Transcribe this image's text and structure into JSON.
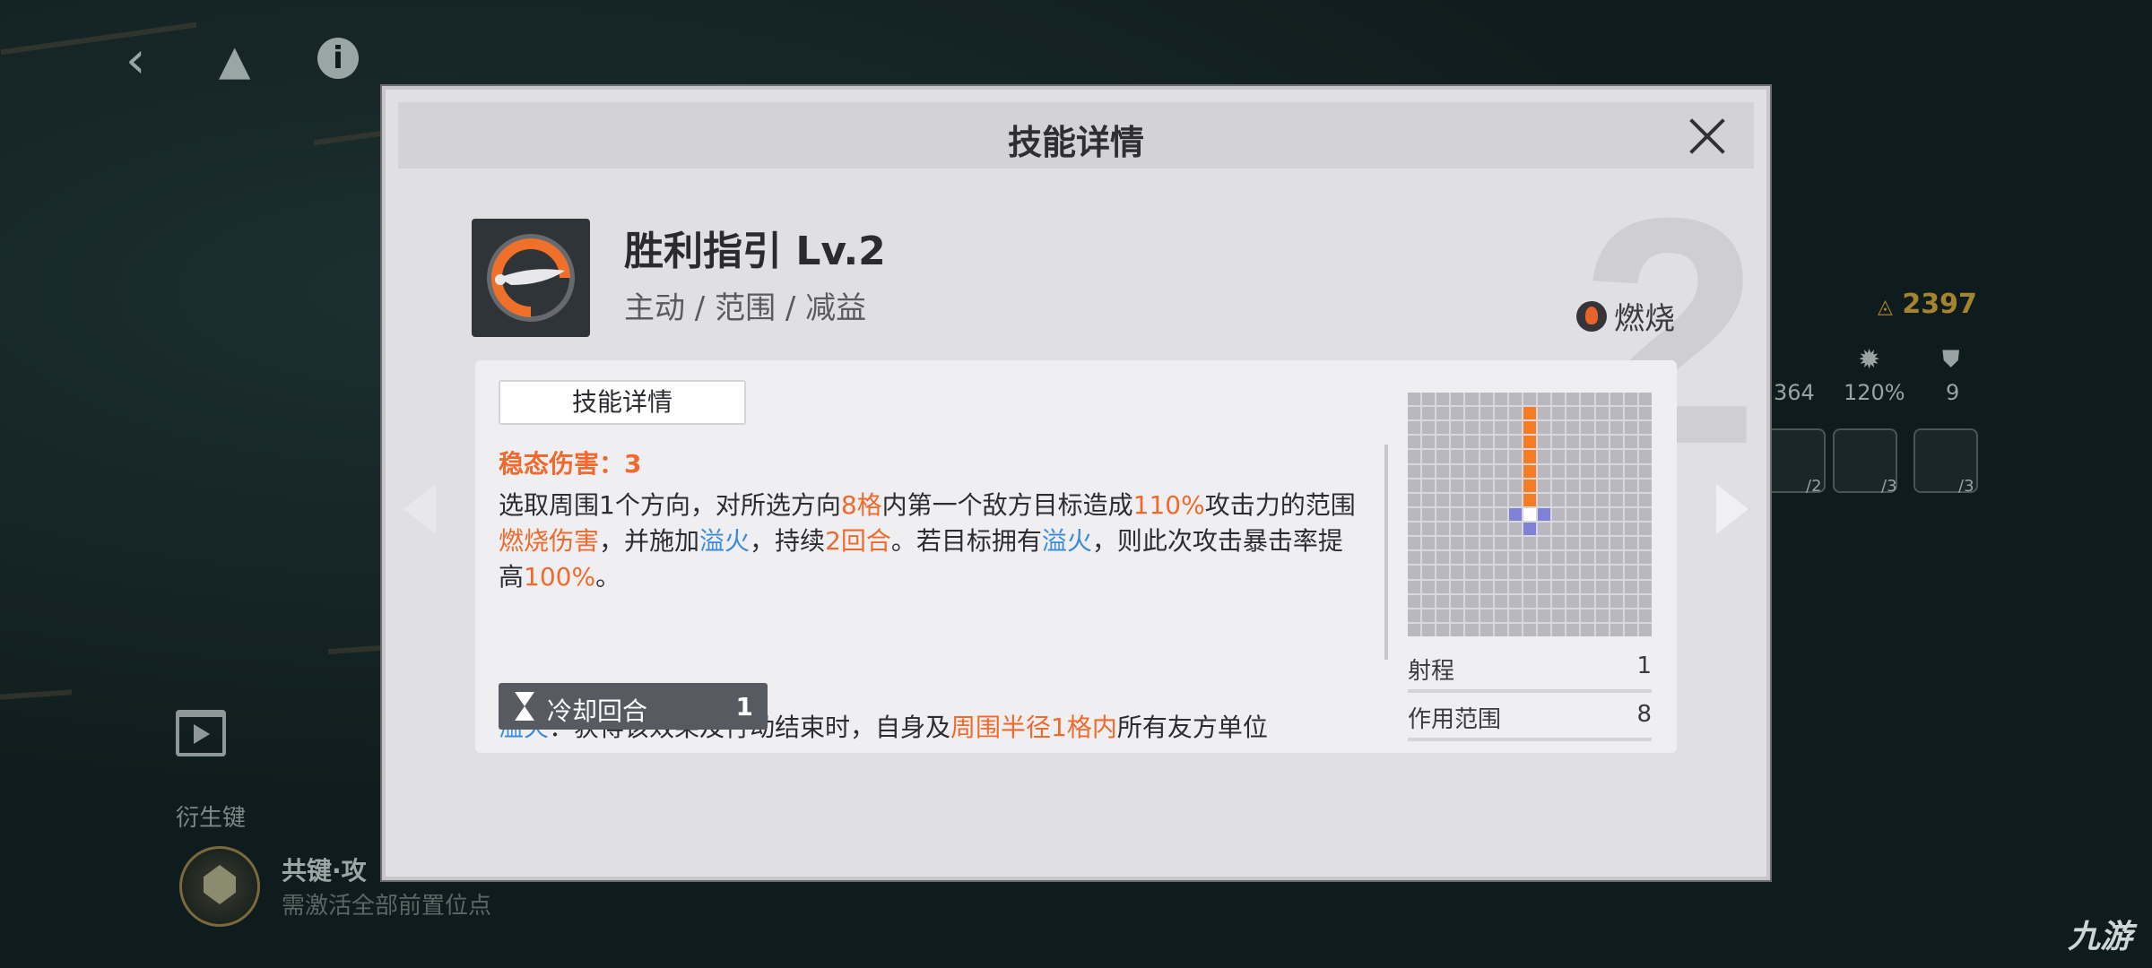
{
  "modal": {
    "title": "技能详情",
    "level_number": "2",
    "skill_name": "胜利指引 Lv.2",
    "skill_tags": "主动 / 范围 / 减益",
    "element_label": "燃烧",
    "tab_label": "技能详情",
    "damage_label": "稳态伤害：3",
    "cooldown_label": "冷却回合",
    "cooldown_value": "1",
    "range_label": "射程",
    "range_value": "1",
    "area_label": "作用范围",
    "area_value": "8",
    "description": {
      "p1": "选取周围1个方向，对所选方向",
      "p2": "8格",
      "p3": "内第一个敌方目标造成",
      "p4": "110%",
      "p5": "攻击力的范围",
      "p6": "燃烧伤害",
      "p7": "，并施加",
      "p8": "溢火",
      "p9": "，持续",
      "p10": "2回合",
      "p11": "。若目标拥有",
      "p12": "溢火",
      "p13": "，则此次攻击暴击率提高",
      "p14": "100%",
      "p15": "。",
      "q1": "溢火",
      "q2": "：获得该效果及行动结束时，自身及",
      "q3": "周围半径1格内",
      "q4": "所有友方单位"
    }
  },
  "background": {
    "gold_value": "2397",
    "stat_a": "364",
    "stat_b": "120%",
    "stat_c": "9",
    "slot_a": "/2",
    "slot_b": "/3",
    "slot_c": "/3",
    "derived_label": "衍生键",
    "shared_key_label": "共键·攻",
    "shared_key_hint": "需激活全部前置位点",
    "watermark": "九游"
  },
  "colors": {
    "accent_orange": "#ef6a2c",
    "accent_blue": "#3a8bd8",
    "range_cell": "#f57c22",
    "center_cell": "#7d82d8"
  },
  "range_grid": {
    "size": 17,
    "center": [
      8,
      8
    ],
    "highlighted_cells": [
      [
        8,
        1
      ],
      [
        8,
        2
      ],
      [
        8,
        3
      ],
      [
        8,
        4
      ],
      [
        8,
        5
      ],
      [
        8,
        6
      ],
      [
        8,
        7
      ]
    ],
    "center_markers": [
      [
        7,
        8
      ],
      [
        9,
        8
      ],
      [
        8,
        9
      ]
    ]
  }
}
